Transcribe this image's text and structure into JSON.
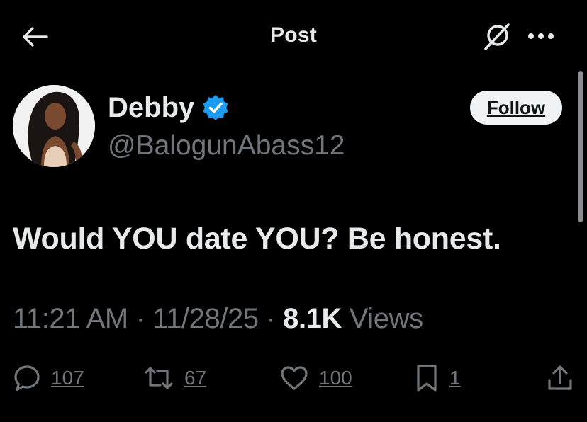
{
  "header": {
    "title": "Post",
    "back_icon": "arrow-left-icon",
    "grok_icon": "grok-icon",
    "more_icon": "more-horizontal-icon"
  },
  "author": {
    "display_name": "Debby",
    "handle": "@BalogunAbass12",
    "verified": true,
    "verified_color": "#1d9bf0",
    "follow_label": "Follow"
  },
  "post": {
    "text": "Would YOU date YOU? Be honest.",
    "time": "11:21 AM",
    "date": "11/28/25",
    "separator": "·",
    "views_count": "8.1K",
    "views_label": "Views"
  },
  "actions": {
    "replies": "107",
    "reposts": "67",
    "likes": "100",
    "bookmarks": "1"
  },
  "colors": {
    "background": "#000000",
    "primary_text": "#e7e9ea",
    "secondary_text": "#71767b",
    "follow_button_bg": "#eff3f4",
    "follow_button_text": "#0f1419"
  }
}
